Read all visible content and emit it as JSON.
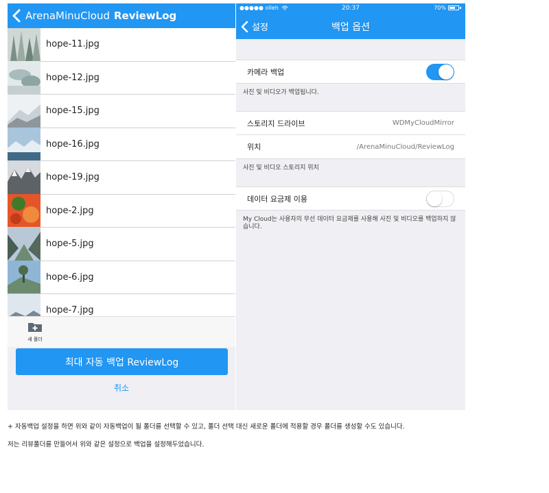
{
  "left_panel": {
    "nav": {
      "path": "ArenaMinuCloud",
      "current": "ReviewLog"
    },
    "files": [
      {
        "name": "hope-11.jpg",
        "thumb": "snowy-forest"
      },
      {
        "name": "hope-12.jpg",
        "thumb": "snowy-trees"
      },
      {
        "name": "hope-15.jpg",
        "thumb": "snowy-mountain"
      },
      {
        "name": "hope-16.jpg",
        "thumb": "mountain-lake"
      },
      {
        "name": "hope-19.jpg",
        "thumb": "rocky-peaks"
      },
      {
        "name": "hope-2.jpg",
        "thumb": "orange-food"
      },
      {
        "name": "hope-5.jpg",
        "thumb": "green-valley"
      },
      {
        "name": "hope-6.jpg",
        "thumb": "hill-tree"
      },
      {
        "name": "hope-7.jpg",
        "thumb": "snow-range"
      }
    ],
    "new_folder_label": "새 폴더",
    "primary_button": "최대 자동 백업 ReviewLog",
    "cancel": "취소"
  },
  "right_panel": {
    "status": {
      "carrier": "●●●●● olleh",
      "time": "20:37",
      "battery": "70%",
      "battery_level": 0.7
    },
    "nav": {
      "back": "설정",
      "title": "백업 옵션"
    },
    "camera_backup": {
      "label": "카메라 백업",
      "enabled": true,
      "note": "사진 및 비디오가 백업됩니다."
    },
    "storage_drive": {
      "label": "스토리지 드라이브",
      "value": "WDMyCloudMirror"
    },
    "location": {
      "label": "위치",
      "value": "/ArenaMinuCloud/ReviewLog"
    },
    "location_note": "사진 및 비디오 스토리지 위치",
    "data_plan": {
      "label": "데이터 요금제 이용",
      "enabled": false,
      "note": "My Cloud는 사용자의 무선 데이터 요금제를 사용해 사진 및 비디오를 백업하지 않습니다."
    }
  },
  "captions": {
    "line1": "+ 자동백업 설정을 하면 위와 같이 자동백업이 될 폴더를 선택할 수 있고, 폴더 선택 대신 새로운 폴더에 적용할 경우 폴더를 생성할 수도 있습니다.",
    "line2": "저는 리뷰폴더를 만들어서 위와 같은 설정으로 백업을 설정해두었습니다."
  },
  "colors": {
    "accent": "#2196f3",
    "background": "#efeff4"
  }
}
